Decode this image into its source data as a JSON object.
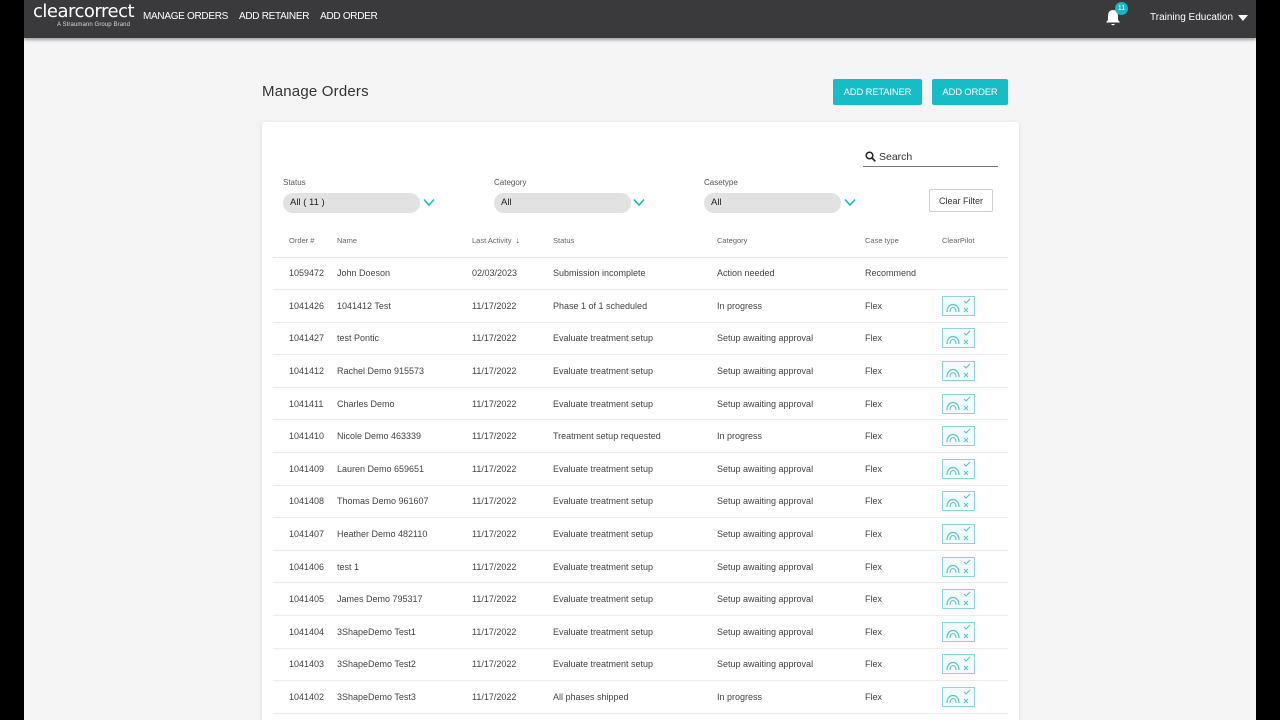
{
  "app": {
    "brand": "clearcorrect",
    "brand_sub": "A Straumann Group Brand",
    "nav": [
      "MANAGE ORDERS",
      "ADD RETAINER",
      "ADD ORDER"
    ],
    "notification_count": "11",
    "user_name": "Training Education"
  },
  "page": {
    "title": "Manage Orders",
    "add_retainer": "ADD RETAINER",
    "add_order": "ADD ORDER"
  },
  "search": {
    "placeholder": "Search"
  },
  "filters": {
    "status_label": "Status",
    "status_value": "All ( 11 )",
    "category_label": "Category",
    "category_value": "All",
    "casetype_label": "Casetype",
    "casetype_value": "All",
    "clear_label": "Clear Filter"
  },
  "table": {
    "columns": [
      "Order #",
      "Name",
      "Last Activity",
      "Status",
      "Category",
      "Case type",
      "ClearPilot"
    ],
    "rows": [
      {
        "order": "1059472",
        "name": "John Doeson",
        "date": "02/03/2023",
        "status": "Submission incomplete",
        "category": "Action needed",
        "case": "Recommend",
        "pilot": false
      },
      {
        "order": "1041426",
        "name": "1041412 Test",
        "date": "11/17/2022",
        "status": "Phase 1 of 1 scheduled",
        "category": "In progress",
        "case": "Flex",
        "pilot": true
      },
      {
        "order": "1041427",
        "name": "test Pontic",
        "date": "11/17/2022",
        "status": "Evaluate treatment setup",
        "category": "Setup awaiting approval",
        "case": "Flex",
        "pilot": true
      },
      {
        "order": "1041412",
        "name": "Rachel Demo 915573",
        "date": "11/17/2022",
        "status": "Evaluate treatment setup",
        "category": "Setup awaiting approval",
        "case": "Flex",
        "pilot": true
      },
      {
        "order": "1041411",
        "name": "Charles Demo",
        "date": "11/17/2022",
        "status": "Evaluate treatment setup",
        "category": "Setup awaiting approval",
        "case": "Flex",
        "pilot": true
      },
      {
        "order": "1041410",
        "name": "Nicole Demo 463339",
        "date": "11/17/2022",
        "status": "Treatment setup requested",
        "category": "In progress",
        "case": "Flex",
        "pilot": true
      },
      {
        "order": "1041409",
        "name": "Lauren Demo 659651",
        "date": "11/17/2022",
        "status": "Evaluate treatment setup",
        "category": "Setup awaiting approval",
        "case": "Flex",
        "pilot": true
      },
      {
        "order": "1041408",
        "name": "Thomas Demo 961607",
        "date": "11/17/2022",
        "status": "Evaluate treatment setup",
        "category": "Setup awaiting approval",
        "case": "Flex",
        "pilot": true
      },
      {
        "order": "1041407",
        "name": "Heather Demo 482110",
        "date": "11/17/2022",
        "status": "Evaluate treatment setup",
        "category": "Setup awaiting approval",
        "case": "Flex",
        "pilot": true
      },
      {
        "order": "1041406",
        "name": "test 1",
        "date": "11/17/2022",
        "status": "Evaluate treatment setup",
        "category": "Setup awaiting approval",
        "case": "Flex",
        "pilot": true
      },
      {
        "order": "1041405",
        "name": "James Demo 795317",
        "date": "11/17/2022",
        "status": "Evaluate treatment setup",
        "category": "Setup awaiting approval",
        "case": "Flex",
        "pilot": true
      },
      {
        "order": "1041404",
        "name": "3ShapeDemo Test1",
        "date": "11/17/2022",
        "status": "Evaluate treatment setup",
        "category": "Setup awaiting approval",
        "case": "Flex",
        "pilot": true
      },
      {
        "order": "1041403",
        "name": "3ShapeDemo Test2",
        "date": "11/17/2022",
        "status": "Evaluate treatment setup",
        "category": "Setup awaiting approval",
        "case": "Flex",
        "pilot": true
      },
      {
        "order": "1041402",
        "name": "3ShapeDemo Test3",
        "date": "11/17/2022",
        "status": "All phases shipped",
        "category": "In progress",
        "case": "Flex",
        "pilot": true
      }
    ]
  },
  "colors": {
    "accent": "#16bdc7",
    "topbar": "#3a3a3c"
  }
}
